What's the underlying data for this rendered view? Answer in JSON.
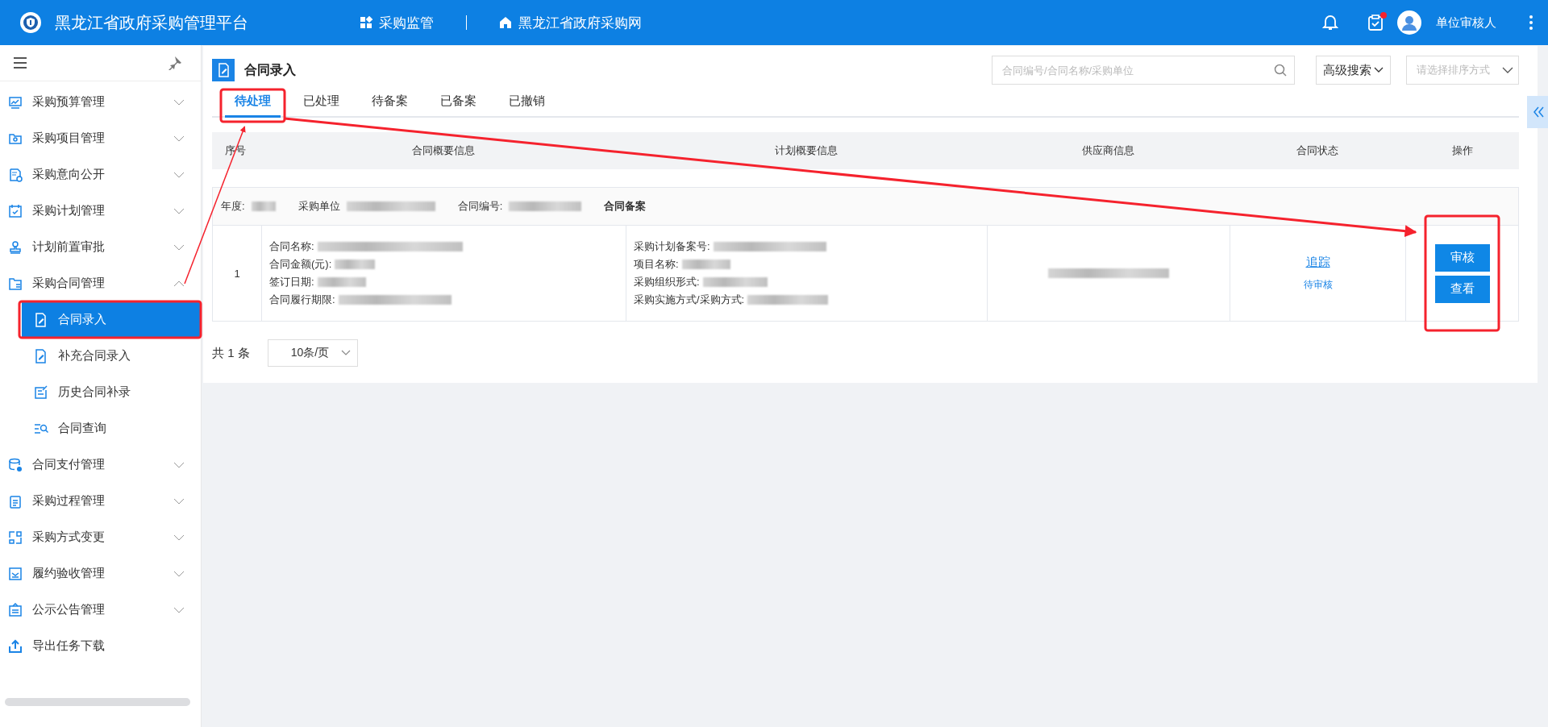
{
  "header": {
    "title": "黑龙江省政府采购管理平台",
    "nav": [
      {
        "label": "采购监管",
        "kind": "grid"
      },
      {
        "label": "黑龙江省政府采购网",
        "kind": "home"
      }
    ],
    "task_badge": true,
    "user": "单位审核人"
  },
  "sidebar": {
    "items": [
      {
        "label": "采购预算管理",
        "kind": "group",
        "expanded": false
      },
      {
        "label": "采购项目管理",
        "kind": "group",
        "expanded": false
      },
      {
        "label": "采购意向公开",
        "kind": "group",
        "expanded": false
      },
      {
        "label": "采购计划管理",
        "kind": "group",
        "expanded": false
      },
      {
        "label": "计划前置审批",
        "kind": "group",
        "expanded": false
      },
      {
        "label": "采购合同管理",
        "kind": "group",
        "expanded": true,
        "children": [
          {
            "label": "合同录入",
            "selected": true,
            "highlighted": true
          },
          {
            "label": "补充合同录入",
            "selected": false,
            "highlighted": false
          },
          {
            "label": "历史合同补录",
            "selected": false,
            "highlighted": false
          },
          {
            "label": "合同查询",
            "selected": false,
            "highlighted": false
          }
        ]
      },
      {
        "label": "合同支付管理",
        "kind": "group",
        "expanded": false
      },
      {
        "label": "采购过程管理",
        "kind": "group",
        "expanded": false
      },
      {
        "label": "采购方式变更",
        "kind": "group",
        "expanded": false
      },
      {
        "label": "履约验收管理",
        "kind": "group",
        "expanded": false
      },
      {
        "label": "公示公告管理",
        "kind": "group",
        "expanded": false
      },
      {
        "label": "导出任务下载",
        "kind": "link"
      }
    ]
  },
  "page": {
    "title": "合同录入",
    "search": {
      "placeholder": "合同编号/合同名称/采购单位"
    },
    "advanced_search": "高级搜索",
    "sort": {
      "placeholder": "请选择排序方式"
    },
    "tabs": [
      {
        "label": "待处理",
        "selected": true,
        "highlighted": true
      },
      {
        "label": "已处理",
        "selected": false,
        "highlighted": false
      },
      {
        "label": "待备案",
        "selected": false,
        "highlighted": false
      },
      {
        "label": "已备案",
        "selected": false,
        "highlighted": false
      },
      {
        "label": "已撤销",
        "selected": false,
        "highlighted": false
      }
    ],
    "table": {
      "columns": [
        "序号",
        "合同概要信息",
        "计划概要信息",
        "供应商信息",
        "合同状态",
        "操作"
      ],
      "records": [
        {
          "header_fields": [
            "年度:",
            "采购单位",
            "合同编号:"
          ],
          "record_type": "合同备案",
          "index": "1",
          "contract_fields": [
            "合同名称:",
            "合同金额(元):",
            "签订日期:",
            "合同履行期限:"
          ],
          "plan_fields": [
            "采购计划备案号:",
            "项目名称:",
            "采购组织形式:",
            "采购实施方式/采购方式:"
          ],
          "track_link": "追踪",
          "status": "待审核",
          "actions": [
            "审核",
            "查看"
          ],
          "actions_highlighted": true
        }
      ]
    },
    "pagination": {
      "total": "共 1 条",
      "page_size": "10条/页"
    }
  }
}
